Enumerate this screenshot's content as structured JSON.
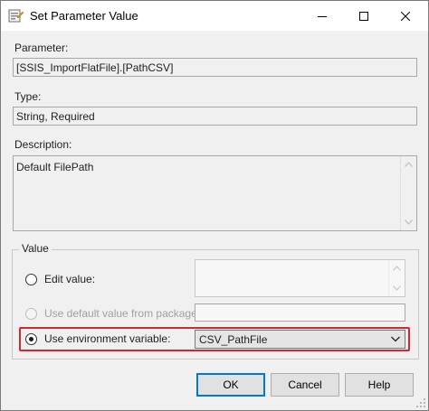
{
  "window": {
    "title": "Set Parameter Value",
    "icon": "ssis-parameter-icon",
    "controls": {
      "minimize": "minimize-icon",
      "maximize": "maximize-icon",
      "close": "close-icon"
    }
  },
  "parameter": {
    "label": "Parameter:",
    "value": "[SSIS_ImportFlatFile].[PathCSV]"
  },
  "type": {
    "label": "Type:",
    "value": "String, Required"
  },
  "description": {
    "label": "Description:",
    "value": "Default FilePath"
  },
  "value_group": {
    "title": "Value",
    "options": {
      "edit": {
        "label": "Edit value:",
        "selected": false,
        "enabled": true
      },
      "default": {
        "label": "Use default value from package",
        "selected": false,
        "enabled": false
      },
      "env": {
        "label": "Use environment variable:",
        "selected": true,
        "enabled": true
      }
    },
    "edit_value": "",
    "default_value": "",
    "env_variable": "CSV_PathFile"
  },
  "buttons": {
    "ok": "OK",
    "cancel": "Cancel",
    "help": "Help"
  },
  "colors": {
    "highlight": "#d9252b",
    "default_button_border": "#0078d7"
  }
}
